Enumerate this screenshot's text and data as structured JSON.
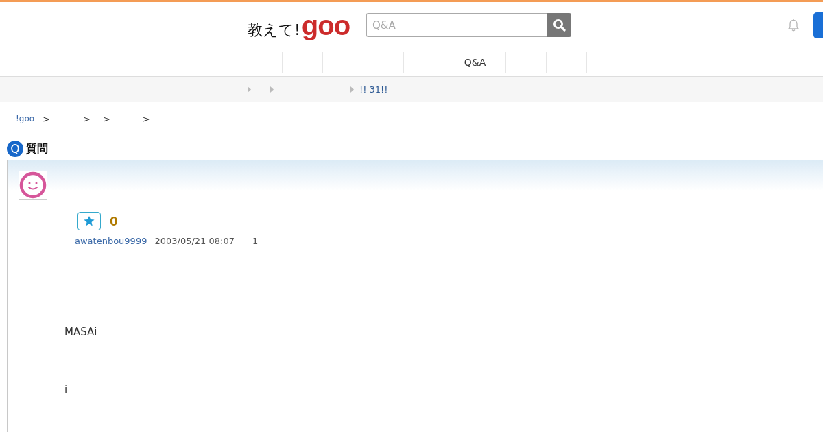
{
  "header": {
    "logo": {
      "text": "教えて!",
      "brand": "goo"
    },
    "search": {
      "placeholder": "Q&A"
    }
  },
  "nav": {
    "items": [
      {
        "kind": "blank"
      },
      {
        "kind": "blank"
      },
      {
        "kind": "blank"
      },
      {
        "kind": "blank"
      },
      {
        "kind": "link",
        "label": "Q&A"
      },
      {
        "kind": "blank"
      },
      {
        "kind": "blank"
      }
    ]
  },
  "ticker": {
    "items": [
      {
        "kind": "blank"
      },
      {
        "kind": "blank"
      },
      {
        "kind": "link",
        "label": "!! 31!!"
      }
    ]
  },
  "breadcrumb": {
    "separator": ">",
    "items": [
      {
        "kind": "link",
        "label": "!goo"
      },
      {
        "kind": "blank"
      },
      {
        "kind": "blank"
      },
      {
        "kind": "blank"
      }
    ]
  },
  "question": {
    "badge": "Q",
    "heading": "質問",
    "star_count": "0",
    "author": "awatenbou9999",
    "posted": "2003/05/21 08:07",
    "meta_3": "1",
    "body": [
      "MASAi",
      "i"
    ]
  }
}
